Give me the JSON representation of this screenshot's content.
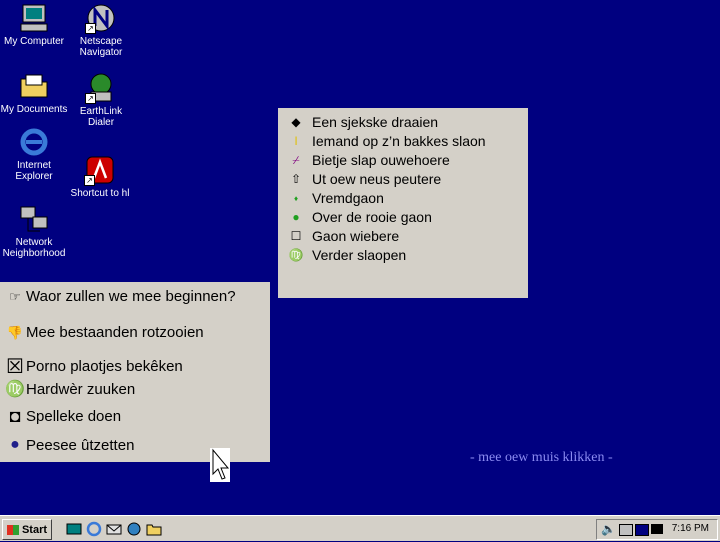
{
  "desktop": {
    "icons": [
      {
        "label_lines": [
          "My Computer"
        ]
      },
      {
        "label_lines": [
          "Netscape",
          "Navigator"
        ]
      },
      {
        "label_lines": [
          "My Documents"
        ]
      },
      {
        "label_lines": [
          "EarthLink",
          "Dialer"
        ]
      },
      {
        "label_lines": [
          "Internet",
          "Explorer"
        ]
      },
      {
        "label_lines": [
          "Shortcut to hl"
        ]
      },
      {
        "label_lines": [
          "Network",
          "Neighborhood"
        ]
      }
    ]
  },
  "menu": {
    "items": [
      {
        "icon": "diamond-icon",
        "label": "Een sjekske draaien"
      },
      {
        "icon": "corner-mark-icon",
        "label": "Iemand op z’n bakkes slaon"
      },
      {
        "icon": "pin-icon",
        "label": "Bietje slap ouwehoere"
      },
      {
        "icon": "up-arrow-outline-icon",
        "label": "Ut oew neus peutere"
      },
      {
        "icon": "small-diamond-icon",
        "label": "Vremdgaon"
      },
      {
        "icon": "green-circle-icon",
        "label": "Over de rooie gaon"
      },
      {
        "icon": "square-outline-icon",
        "label": "Gaon wiebere"
      },
      {
        "icon": "zodiac-icon",
        "label": "Verder slaopen"
      }
    ]
  },
  "chat": {
    "items": [
      {
        "icon": "pointing-hand-icon",
        "label": "Waor zullen we mee beginnen?"
      },
      {
        "icon": "thumbs-down-icon",
        "label": "Mee bestaanden rotzooien"
      },
      {
        "icon": "checkbox-x-icon",
        "label": "Porno plaotjes bekêken"
      },
      {
        "icon": "zodiac-icon",
        "label": "Hardwèr zuuken"
      },
      {
        "icon": "square-icon",
        "label": "Spelleke doen"
      },
      {
        "icon": "circle-icon",
        "label": "Peesee ûtzetten"
      }
    ]
  },
  "hint": "- mee oew muis klikken -",
  "taskbar": {
    "start_label": "Start",
    "clock": "7:16 PM",
    "quick_launch": [
      "desktop-icon",
      "ie-icon",
      "outlook-icon",
      "channels-icon",
      "explorer-icon"
    ]
  },
  "colors": {
    "desktop": "#000080",
    "panel": "#d4d0c8",
    "hint": "#8a8af0"
  }
}
